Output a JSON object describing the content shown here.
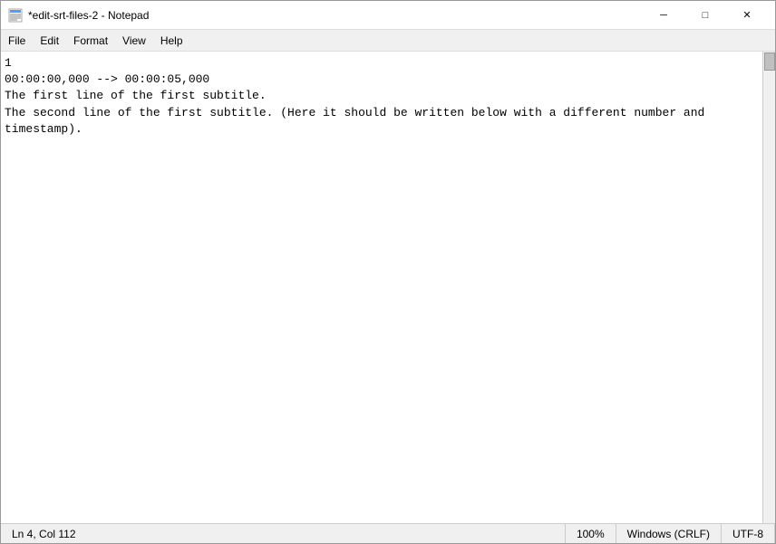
{
  "window": {
    "title": "*edit-srt-files-2 - Notepad",
    "icon": "notepad"
  },
  "titlebar": {
    "minimize_label": "─",
    "maximize_label": "□",
    "close_label": "✕"
  },
  "menu": {
    "items": [
      {
        "label": "File"
      },
      {
        "label": "Edit"
      },
      {
        "label": "Format"
      },
      {
        "label": "View"
      },
      {
        "label": "Help"
      }
    ]
  },
  "editor": {
    "content": "1\n00:00:00,000 --> 00:00:05,000\nThe first line of the first subtitle.\nThe second line of the first subtitle. (Here it should be written below with a different number and timestamp)."
  },
  "statusbar": {
    "position": "Ln 4, Col 112",
    "zoom": "100%",
    "line_ending": "Windows (CRLF)",
    "encoding": "UTF-8"
  }
}
